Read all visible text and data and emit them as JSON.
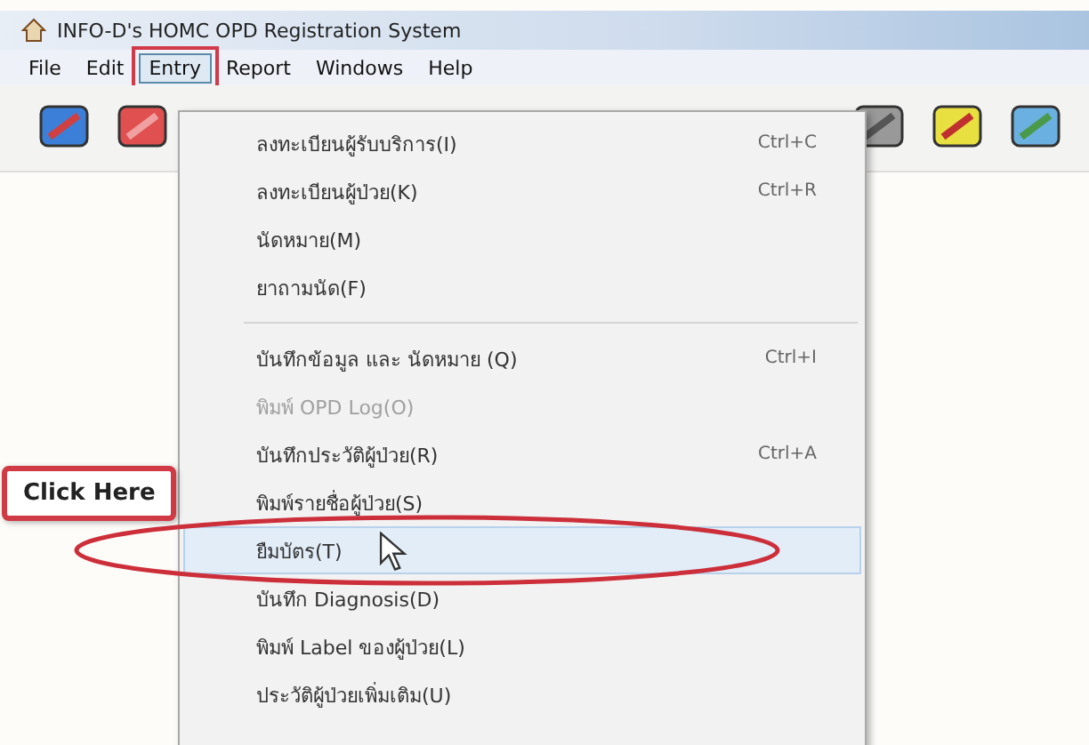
{
  "window": {
    "title": "INFO-D's HOMC OPD Registration System"
  },
  "menubar": [
    {
      "label": "File",
      "selected": false
    },
    {
      "label": "Edit",
      "selected": false
    },
    {
      "label": "Entry",
      "selected": true
    },
    {
      "label": "Report",
      "selected": false
    },
    {
      "label": "Windows",
      "selected": false
    },
    {
      "label": "Help",
      "selected": false
    }
  ],
  "menu": [
    {
      "kind": "item",
      "label": "ลงทะเบียนผู้รับบริการ(I)",
      "shortcut": "Ctrl+C",
      "disabled": false,
      "selected": false
    },
    {
      "kind": "item",
      "label": "ลงทะเบียนผู้ป่วย(K)",
      "shortcut": "Ctrl+R",
      "disabled": false,
      "selected": false
    },
    {
      "kind": "item",
      "label": "นัดหมาย(M)",
      "disabled": false,
      "selected": false
    },
    {
      "kind": "item",
      "label": "ยาถามนัด(F)",
      "disabled": false,
      "selected": false
    },
    {
      "kind": "separator"
    },
    {
      "kind": "item",
      "label": "บันทึกข้อมูล และ นัดหมาย (Q)",
      "shortcut": "Ctrl+I",
      "disabled": false,
      "selected": false
    },
    {
      "kind": "item",
      "label": "พิมพ์ OPD Log(O)",
      "disabled": true,
      "selected": false
    },
    {
      "kind": "item",
      "label": "บันทึกประวัติผู้ป่วย(R)",
      "shortcut": "Ctrl+A",
      "disabled": false,
      "selected": false
    },
    {
      "kind": "item",
      "label": "พิมพ์รายชื่อผู้ป่วย(S)",
      "disabled": false,
      "selected": false
    },
    {
      "kind": "item",
      "label": "ยืมบัตร(T)",
      "disabled": false,
      "selected": true
    },
    {
      "kind": "item",
      "label": "บันทึก Diagnosis(D)",
      "disabled": false,
      "selected": false
    },
    {
      "kind": "item",
      "label": "พิมพ์ Label ของผู้ป่วย(L)",
      "disabled": false,
      "selected": false
    },
    {
      "kind": "item",
      "label": "ประวัติผู้ป่วยเพิ่มเติม(U)",
      "disabled": false,
      "selected": false
    }
  ],
  "callout": {
    "text": "Click Here"
  }
}
